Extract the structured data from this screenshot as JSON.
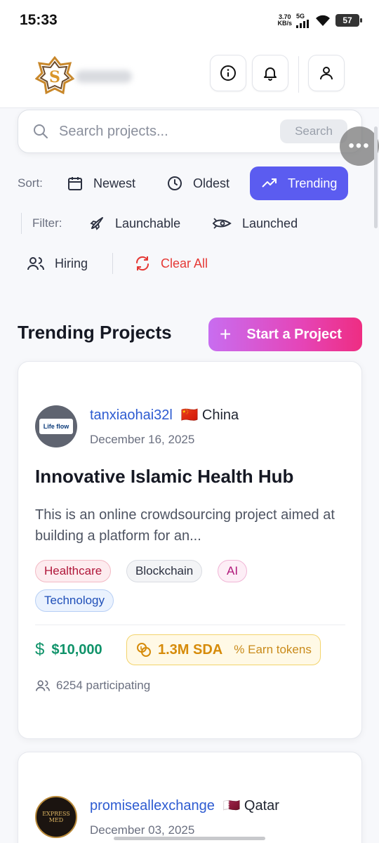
{
  "status_bar": {
    "time": "15:33",
    "speed_value": "3.70",
    "speed_unit": "KB/s",
    "network": "5G",
    "battery": "57"
  },
  "header": {
    "logo_icon": "brand-logo-icon",
    "buttons": [
      "info-icon",
      "bell-icon",
      "user-icon"
    ]
  },
  "search": {
    "placeholder": "Search projects...",
    "button_label": "Search"
  },
  "floating_button": "•••",
  "sort": {
    "label": "Sort:",
    "options": [
      {
        "label": "Newest",
        "icon": "calendar-icon"
      },
      {
        "label": "Oldest",
        "icon": "clock-icon"
      },
      {
        "label": "Trending",
        "icon": "trending-up-icon",
        "active": true
      }
    ]
  },
  "filter": {
    "label": "Filter:",
    "options": [
      {
        "label": "Launchable",
        "icon": "rocket-icon"
      },
      {
        "label": "Launched",
        "icon": "launched-icon"
      },
      {
        "label": "Hiring",
        "icon": "users-icon"
      }
    ],
    "clear_label": "Clear All"
  },
  "section": {
    "title": "Trending Projects",
    "start_button": "Start a Project"
  },
  "projects": [
    {
      "username": "tanxiaohai32l",
      "flag": "🇨🇳",
      "country": "China",
      "date": "December 16, 2025",
      "avatar_text": "Life flow",
      "title": "Innovative Islamic Health Hub",
      "description": "This is an online crowdsourcing project aimed at building a platform for an...",
      "tags": [
        "Healthcare",
        "Blockchain",
        "AI",
        "Technology"
      ],
      "funding": "$10,000",
      "tokens": "1.3M SDA",
      "earn_label": "Earn tokens",
      "participants": "6254 participating"
    },
    {
      "username": "promiseallexchange",
      "flag": "🇶🇦",
      "country": "Qatar",
      "date": "December 03, 2025",
      "avatar_text": "EXPRESS MED"
    }
  ],
  "colors": {
    "accent": "#5b5cf0",
    "link": "#2d5bd1",
    "danger": "#e53935",
    "money": "#10936a",
    "token": "#d68b0a"
  }
}
